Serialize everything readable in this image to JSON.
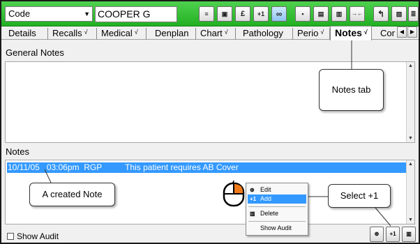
{
  "toolbar": {
    "code_value": "Code",
    "patient_name": "COOPER G",
    "buttons": {
      "note": "≡",
      "gift": "▣",
      "pound": "£",
      "plus_one": "+1",
      "link": "∞",
      "save": "▪",
      "print": "▤",
      "delete": "▥",
      "merge": "→←",
      "phone": "↰",
      "doc": "▨",
      "notes2": "≣"
    }
  },
  "tabs": {
    "details": "Details",
    "recalls": "Recalls",
    "medical": "Medical",
    "denplan": "Denplan",
    "chart": "Chart",
    "pathology": "Pathology",
    "perio": "Perio",
    "notes": "Notes",
    "cor": "Cor",
    "tick": "√",
    "scroll_left": "◀",
    "scroll_right": "▶"
  },
  "general_notes": {
    "label": "General Notes"
  },
  "notes": {
    "label": "Notes",
    "row": "10/11/05   03:06pm  RGP          This patient requires AB Cover"
  },
  "callouts": {
    "notes_tab": "Notes tab",
    "created_note": "A created Note",
    "select_plus_one": "Select +1"
  },
  "context_menu": {
    "edit": "Edit",
    "add": "Add",
    "delete": "Delete",
    "show_audit": "Show Audit",
    "edit_icon": "⊕",
    "add_icon": "+1",
    "delete_icon": "▥"
  },
  "bottom": {
    "show_audit": "Show Audit",
    "edit_btn": "⊕",
    "plus_one_btn": "+1",
    "delete_btn": "▥"
  },
  "colors": {
    "toolbar_green": "#2ab82a",
    "selection_blue": "#3399ff",
    "mouse_button_orange": "#f07a1a"
  }
}
